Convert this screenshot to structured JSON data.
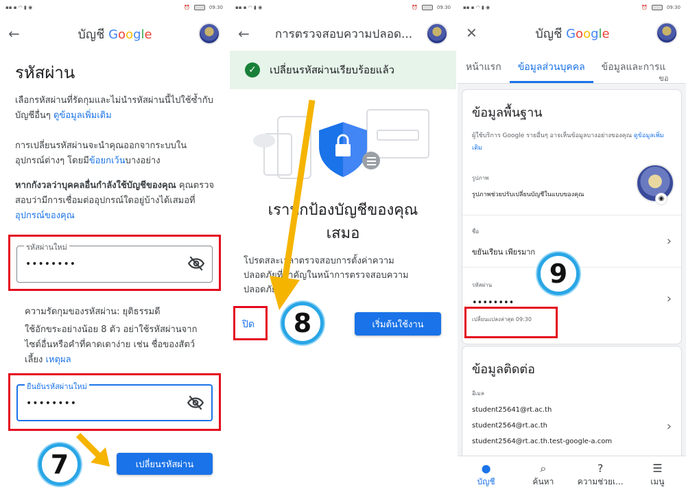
{
  "status": {
    "time": "09:30",
    "battery": "52"
  },
  "panel1": {
    "header_prefix": "บัญชี",
    "header_brand": [
      "G",
      "o",
      "o",
      "g",
      "l",
      "e"
    ],
    "title": "รหัสผ่าน",
    "intro": "เลือกรหัสผ่านที่รัดกุมและไม่นำรหัสผ่านนี้ไปใช้ซ้ำกับบัญชีอื่นๆ",
    "intro_link": "ดูข้อมูลเพิ่มเติม",
    "signout_text": "การเปลี่ยนรหัสผ่านจะนำคุณออกจากระบบในอุปกรณ์ต่างๆ โดยมี",
    "signout_link": "ข้อยกเว้น",
    "signout_suffix": "บางอย่าง",
    "worry_bold": "หากกังวลว่าบุคคลอื่นกำลังใช้บัญชีของคุณ",
    "worry_text": "คุณตรวจสอบว่ามีการเชื่อมต่ออุปกรณ์ใดอยู่บ้างได้เสมอที่",
    "worry_link": "อุปกรณ์ของคุณ",
    "new_pw_label": "รหัสผ่านใหม่",
    "new_pw_value": "••••••••",
    "strength": "ความรัดกุมของรหัสผ่าน: ยุติธรรมดี",
    "strength_hint": "ใช้อักขระอย่างน้อย 8 ตัว อย่าใช้รหัสผ่านจากไซต์อื่นหรือคำที่คาดเดาง่าย เช่น ชื่อของสัตว์เลี้ยง",
    "strength_link": "เหตุผล",
    "confirm_label": "ยืนยันรหัสผ่านใหม่",
    "confirm_value": "••••••••",
    "change_button": "เปลี่ยนรหัสผ่าน",
    "marker": "7"
  },
  "panel2": {
    "header_title": "การตรวจสอบความปลอด...",
    "banner": "เปลี่ยนรหัสผ่านเรียบร้อยแล้ว",
    "headline_1": "เราปกป้องบัญชีของคุณ",
    "headline_2": "เสมอ",
    "body_line_1": "โปรดสละเวลาตรวจสอบการตั้งค่าความ",
    "body_line_2": "ปลอดภัยที่สำคัญในหน้าการตรวจสอบความ",
    "body_line_3": "ปลอดภัย",
    "close_button": "ปิด",
    "start_button": "เริ่มต้นใช้งาน",
    "marker": "8"
  },
  "panel3": {
    "header_prefix": "บัญชี",
    "header_brand": [
      "G",
      "o",
      "o",
      "g",
      "l",
      "e"
    ],
    "tabs": [
      "หน้าแรก",
      "ข้อมูลส่วนบุคคล",
      "ข้อมูลและการแ"
    ],
    "tab_overflow": "ขอ",
    "basic_title": "ข้อมูลพื้นฐาน",
    "basic_desc": "ผู้ใช้บริการ Google รายอื่นๆ อาจเห็นข้อมูลบางอย่างของคุณ",
    "basic_link": "ดูข้อมูลเพิ่มเติม",
    "photo_label": "รูปภาพ",
    "photo_desc": "รูปภาพช่วยปรับเปลี่ยนบัญชีในแบบของคุณ",
    "name_label": "ชื่อ",
    "name_value": "ขยันเรียน เพียรมาก",
    "pw_label": "รหัสผ่าน",
    "pw_value": "••••••••",
    "pw_changed": "เปลี่ยนแปลงล่าสุด 09:30",
    "contact_title": "ข้อมูลติดต่อ",
    "email_label": "อีเมล",
    "emails": [
      "student25641@rt.ac.th",
      "student2564@rt.ac.th",
      "student2564@rt.ac.th.test-google-a.com"
    ],
    "nav": [
      "บัญชี",
      "ค้นหา",
      "ความช่วยเ...",
      "เมนู"
    ],
    "marker": "9"
  },
  "colors": {
    "google_blue": "#4285f4",
    "google_red": "#ea4335",
    "google_yellow": "#fbbc05",
    "google_green": "#34a853",
    "annotation_red": "#e4081e",
    "annotation_arrow": "#f5b400",
    "marker_ring": "#29a6e6"
  }
}
